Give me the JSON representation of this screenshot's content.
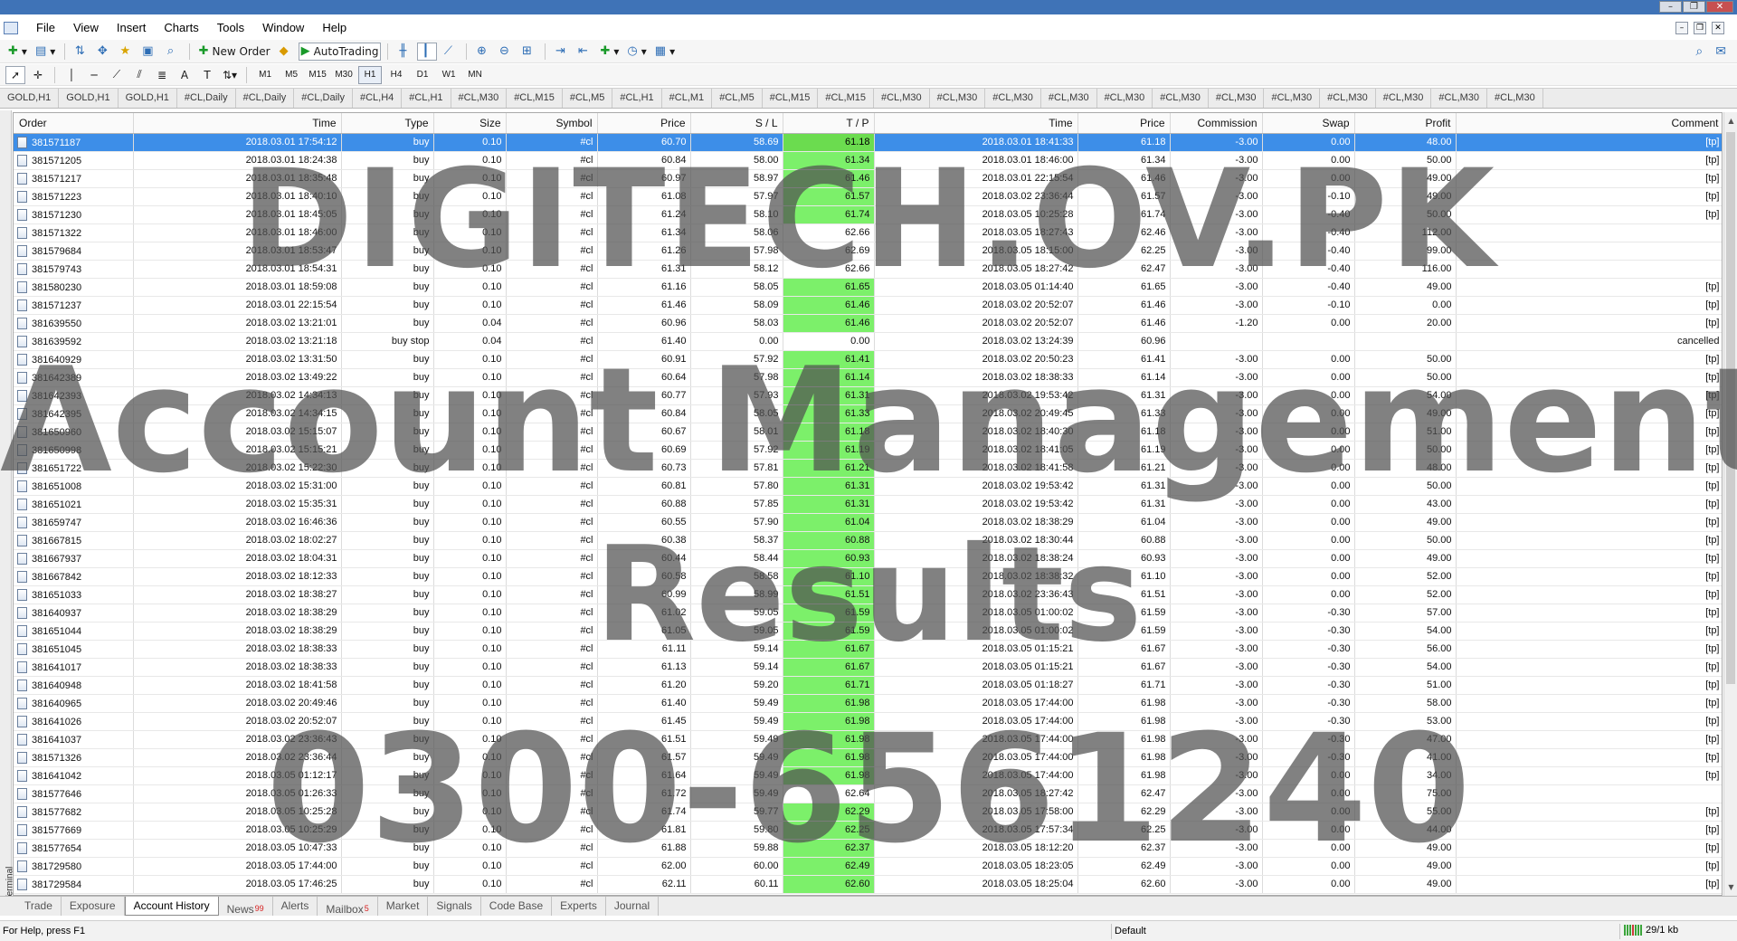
{
  "menu": [
    "File",
    "View",
    "Insert",
    "Charts",
    "Tools",
    "Window",
    "Help"
  ],
  "toolbar": {
    "new_order": "New Order",
    "autotrading": "AutoTrading"
  },
  "timeframes": [
    "M1",
    "M5",
    "M15",
    "M30",
    "H1",
    "H4",
    "D1",
    "W1",
    "MN"
  ],
  "active_timeframe": "H1",
  "chart_tabs": [
    "GOLD,H1",
    "GOLD,H1",
    "GOLD,H1",
    "#CL,Daily",
    "#CL,Daily",
    "#CL,Daily",
    "#CL,H4",
    "#CL,H1",
    "#CL,M30",
    "#CL,M15",
    "#CL,M5",
    "#CL,H1",
    "#CL,M1",
    "#CL,M5",
    "#CL,M15",
    "#CL,M15",
    "#CL,M30",
    "#CL,M30",
    "#CL,M30",
    "#CL,M30",
    "#CL,M30",
    "#CL,M30",
    "#CL,M30",
    "#CL,M30",
    "#CL,M30",
    "#CL,M30",
    "#CL,M30",
    "#CL,M30"
  ],
  "columns": [
    "Order",
    "Time",
    "Type",
    "Size",
    "Symbol",
    "Price",
    "S / L",
    "T / P",
    "Time",
    "Price",
    "Commission",
    "Swap",
    "Profit",
    "Comment"
  ],
  "rows": [
    [
      "381571187",
      "2018.03.01 17:54:12",
      "buy",
      "0.10",
      "#cl",
      "60.70",
      "58.69",
      "61.18",
      "2018.03.01 18:41:33",
      "61.18",
      "-3.00",
      "0.00",
      "48.00",
      "[tp]"
    ],
    [
      "381571205",
      "2018.03.01 18:24:38",
      "buy",
      "0.10",
      "#cl",
      "60.84",
      "58.00",
      "61.34",
      "2018.03.01 18:46:00",
      "61.34",
      "-3.00",
      "0.00",
      "50.00",
      "[tp]"
    ],
    [
      "381571217",
      "2018.03.01 18:35:48",
      "buy",
      "0.10",
      "#cl",
      "60.97",
      "58.97",
      "61.46",
      "2018.03.01 22:15:54",
      "61.46",
      "-3.00",
      "0.00",
      "49.00",
      "[tp]"
    ],
    [
      "381571223",
      "2018.03.01 18:40:10",
      "buy",
      "0.10",
      "#cl",
      "61.08",
      "57.97",
      "61.57",
      "2018.03.02 23:36:44",
      "61.57",
      "-3.00",
      "-0.10",
      "49.00",
      "[tp]"
    ],
    [
      "381571230",
      "2018.03.01 18:45:05",
      "buy",
      "0.10",
      "#cl",
      "61.24",
      "58.10",
      "61.74",
      "2018.03.05 10:25:28",
      "61.74",
      "-3.00",
      "-0.40",
      "50.00",
      "[tp]"
    ],
    [
      "381571322",
      "2018.03.01 18:46:00",
      "buy",
      "0.10",
      "#cl",
      "61.34",
      "58.06",
      "62.66",
      "2018.03.05 18:27:43",
      "62.46",
      "-3.00",
      "-0.40",
      "112.00",
      ""
    ],
    [
      "381579684",
      "2018.03.01 18:53:47",
      "buy",
      "0.10",
      "#cl",
      "61.26",
      "57.98",
      "62.69",
      "2018.03.05 18:15:00",
      "62.25",
      "-3.00",
      "-0.40",
      "99.00",
      ""
    ],
    [
      "381579743",
      "2018.03.01 18:54:31",
      "buy",
      "0.10",
      "#cl",
      "61.31",
      "58.12",
      "62.66",
      "2018.03.05 18:27:42",
      "62.47",
      "-3.00",
      "-0.40",
      "116.00",
      ""
    ],
    [
      "381580230",
      "2018.03.01 18:59:08",
      "buy",
      "0.10",
      "#cl",
      "61.16",
      "58.05",
      "61.65",
      "2018.03.05 01:14:40",
      "61.65",
      "-3.00",
      "-0.40",
      "49.00",
      "[tp]"
    ],
    [
      "381571237",
      "2018.03.01 22:15:54",
      "buy",
      "0.10",
      "#cl",
      "61.46",
      "58.09",
      "61.46",
      "2018.03.02 20:52:07",
      "61.46",
      "-3.00",
      "-0.10",
      "0.00",
      "[tp]"
    ],
    [
      "381639550",
      "2018.03.02 13:21:01",
      "buy",
      "0.04",
      "#cl",
      "60.96",
      "58.03",
      "61.46",
      "2018.03.02 20:52:07",
      "61.46",
      "-1.20",
      "0.00",
      "20.00",
      "[tp]"
    ],
    [
      "381639592",
      "2018.03.02 13:21:18",
      "buy stop",
      "0.04",
      "#cl",
      "61.40",
      "0.00",
      "0.00",
      "2018.03.02 13:24:39",
      "60.96",
      "",
      "",
      "",
      "cancelled"
    ],
    [
      "381640929",
      "2018.03.02 13:31:50",
      "buy",
      "0.10",
      "#cl",
      "60.91",
      "57.92",
      "61.41",
      "2018.03.02 20:50:23",
      "61.41",
      "-3.00",
      "0.00",
      "50.00",
      "[tp]"
    ],
    [
      "381642389",
      "2018.03.02 13:49:22",
      "buy",
      "0.10",
      "#cl",
      "60.64",
      "57.98",
      "61.14",
      "2018.03.02 18:38:33",
      "61.14",
      "-3.00",
      "0.00",
      "50.00",
      "[tp]"
    ],
    [
      "381642393",
      "2018.03.02 14:34:13",
      "buy",
      "0.10",
      "#cl",
      "60.77",
      "57.93",
      "61.31",
      "2018.03.02 19:53:42",
      "61.31",
      "-3.00",
      "0.00",
      "54.00",
      "[tp]"
    ],
    [
      "381642395",
      "2018.03.02 14:34:15",
      "buy",
      "0.10",
      "#cl",
      "60.84",
      "58.05",
      "61.33",
      "2018.03.02 20:49:45",
      "61.33",
      "-3.00",
      "0.00",
      "49.00",
      "[tp]"
    ],
    [
      "381650960",
      "2018.03.02 15:15:07",
      "buy",
      "0.10",
      "#cl",
      "60.67",
      "58.01",
      "61.18",
      "2018.03.02 18:40:30",
      "61.18",
      "-3.00",
      "0.00",
      "51.00",
      "[tp]"
    ],
    [
      "381650998",
      "2018.03.02 15:15:21",
      "buy",
      "0.10",
      "#cl",
      "60.69",
      "57.92",
      "61.19",
      "2018.03.02 18:41:05",
      "61.19",
      "-3.00",
      "0.00",
      "50.00",
      "[tp]"
    ],
    [
      "381651722",
      "2018.03.02 15:22:30",
      "buy",
      "0.10",
      "#cl",
      "60.73",
      "57.81",
      "61.21",
      "2018.03.02 18:41:58",
      "61.21",
      "-3.00",
      "0.00",
      "48.00",
      "[tp]"
    ],
    [
      "381651008",
      "2018.03.02 15:31:00",
      "buy",
      "0.10",
      "#cl",
      "60.81",
      "57.80",
      "61.31",
      "2018.03.02 19:53:42",
      "61.31",
      "-3.00",
      "0.00",
      "50.00",
      "[tp]"
    ],
    [
      "381651021",
      "2018.03.02 15:35:31",
      "buy",
      "0.10",
      "#cl",
      "60.88",
      "57.85",
      "61.31",
      "2018.03.02 19:53:42",
      "61.31",
      "-3.00",
      "0.00",
      "43.00",
      "[tp]"
    ],
    [
      "381659747",
      "2018.03.02 16:46:36",
      "buy",
      "0.10",
      "#cl",
      "60.55",
      "57.90",
      "61.04",
      "2018.03.02 18:38:29",
      "61.04",
      "-3.00",
      "0.00",
      "49.00",
      "[tp]"
    ],
    [
      "381667815",
      "2018.03.02 18:02:27",
      "buy",
      "0.10",
      "#cl",
      "60.38",
      "58.37",
      "60.88",
      "2018.03.02 18:30:44",
      "60.88",
      "-3.00",
      "0.00",
      "50.00",
      "[tp]"
    ],
    [
      "381667937",
      "2018.03.02 18:04:31",
      "buy",
      "0.10",
      "#cl",
      "60.44",
      "58.44",
      "60.93",
      "2018.03.02 18:38:24",
      "60.93",
      "-3.00",
      "0.00",
      "49.00",
      "[tp]"
    ],
    [
      "381667842",
      "2018.03.02 18:12:33",
      "buy",
      "0.10",
      "#cl",
      "60.58",
      "58.58",
      "61.10",
      "2018.03.02 18:38:32",
      "61.10",
      "-3.00",
      "0.00",
      "52.00",
      "[tp]"
    ],
    [
      "381651033",
      "2018.03.02 18:38:27",
      "buy",
      "0.10",
      "#cl",
      "60.99",
      "58.99",
      "61.51",
      "2018.03.02 23:36:43",
      "61.51",
      "-3.00",
      "0.00",
      "52.00",
      "[tp]"
    ],
    [
      "381640937",
      "2018.03.02 18:38:29",
      "buy",
      "0.10",
      "#cl",
      "61.02",
      "59.05",
      "61.59",
      "2018.03.05 01:00:02",
      "61.59",
      "-3.00",
      "-0.30",
      "57.00",
      "[tp]"
    ],
    [
      "381651044",
      "2018.03.02 18:38:29",
      "buy",
      "0.10",
      "#cl",
      "61.05",
      "59.05",
      "61.59",
      "2018.03.05 01:00:02",
      "61.59",
      "-3.00",
      "-0.30",
      "54.00",
      "[tp]"
    ],
    [
      "381651045",
      "2018.03.02 18:38:33",
      "buy",
      "0.10",
      "#cl",
      "61.11",
      "59.14",
      "61.67",
      "2018.03.05 01:15:21",
      "61.67",
      "-3.00",
      "-0.30",
      "56.00",
      "[tp]"
    ],
    [
      "381641017",
      "2018.03.02 18:38:33",
      "buy",
      "0.10",
      "#cl",
      "61.13",
      "59.14",
      "61.67",
      "2018.03.05 01:15:21",
      "61.67",
      "-3.00",
      "-0.30",
      "54.00",
      "[tp]"
    ],
    [
      "381640948",
      "2018.03.02 18:41:58",
      "buy",
      "0.10",
      "#cl",
      "61.20",
      "59.20",
      "61.71",
      "2018.03.05 01:18:27",
      "61.71",
      "-3.00",
      "-0.30",
      "51.00",
      "[tp]"
    ],
    [
      "381640965",
      "2018.03.02 20:49:46",
      "buy",
      "0.10",
      "#cl",
      "61.40",
      "59.49",
      "61.98",
      "2018.03.05 17:44:00",
      "61.98",
      "-3.00",
      "-0.30",
      "58.00",
      "[tp]"
    ],
    [
      "381641026",
      "2018.03.02 20:52:07",
      "buy",
      "0.10",
      "#cl",
      "61.45",
      "59.49",
      "61.98",
      "2018.03.05 17:44:00",
      "61.98",
      "-3.00",
      "-0.30",
      "53.00",
      "[tp]"
    ],
    [
      "381641037",
      "2018.03.02 23:36:43",
      "buy",
      "0.10",
      "#cl",
      "61.51",
      "59.49",
      "61.98",
      "2018.03.05 17:44:00",
      "61.98",
      "-3.00",
      "-0.30",
      "47.00",
      "[tp]"
    ],
    [
      "381571326",
      "2018.03.02 23:36:44",
      "buy",
      "0.10",
      "#cl",
      "61.57",
      "59.49",
      "61.98",
      "2018.03.05 17:44:00",
      "61.98",
      "-3.00",
      "-0.30",
      "41.00",
      "[tp]"
    ],
    [
      "381641042",
      "2018.03.05 01:12:17",
      "buy",
      "0.10",
      "#cl",
      "61.64",
      "59.49",
      "61.98",
      "2018.03.05 17:44:00",
      "61.98",
      "-3.00",
      "0.00",
      "34.00",
      "[tp]"
    ],
    [
      "381577646",
      "2018.03.05 01:26:33",
      "buy",
      "0.10",
      "#cl",
      "61.72",
      "59.49",
      "62.64",
      "2018.03.05 18:27:42",
      "62.47",
      "-3.00",
      "0.00",
      "75.00",
      ""
    ],
    [
      "381577682",
      "2018.03.05 10:25:28",
      "buy",
      "0.10",
      "#cl",
      "61.74",
      "59.77",
      "62.29",
      "2018.03.05 17:58:00",
      "62.29",
      "-3.00",
      "0.00",
      "55.00",
      "[tp]"
    ],
    [
      "381577669",
      "2018.03.05 10:25:29",
      "buy",
      "0.10",
      "#cl",
      "61.81",
      "59.80",
      "62.25",
      "2018.03.05 17:57:34",
      "62.25",
      "-3.00",
      "0.00",
      "44.00",
      "[tp]"
    ],
    [
      "381577654",
      "2018.03.05 10:47:33",
      "buy",
      "0.10",
      "#cl",
      "61.88",
      "59.88",
      "62.37",
      "2018.03.05 18:12:20",
      "62.37",
      "-3.00",
      "0.00",
      "49.00",
      "[tp]"
    ],
    [
      "381729580",
      "2018.03.05 17:44:00",
      "buy",
      "0.10",
      "#cl",
      "62.00",
      "60.00",
      "62.49",
      "2018.03.05 18:23:05",
      "62.49",
      "-3.00",
      "0.00",
      "49.00",
      "[tp]"
    ],
    [
      "381729584",
      "2018.03.05 17:46:25",
      "buy",
      "0.10",
      "#cl",
      "62.11",
      "60.11",
      "62.60",
      "2018.03.05 18:25:04",
      "62.60",
      "-3.00",
      "0.00",
      "49.00",
      "[tp]"
    ]
  ],
  "selected_row": 0,
  "terminal_label": "Terminal",
  "bottom_tabs": [
    {
      "label": "Trade",
      "badge": ""
    },
    {
      "label": "Exposure",
      "badge": ""
    },
    {
      "label": "Account History",
      "badge": ""
    },
    {
      "label": "News",
      "badge": "99"
    },
    {
      "label": "Alerts",
      "badge": ""
    },
    {
      "label": "Mailbox",
      "badge": "5"
    },
    {
      "label": "Market",
      "badge": ""
    },
    {
      "label": "Signals",
      "badge": ""
    },
    {
      "label": "Code Base",
      "badge": ""
    },
    {
      "label": "Experts",
      "badge": ""
    },
    {
      "label": "Journal",
      "badge": ""
    }
  ],
  "active_bottom_tab": "Account History",
  "status": {
    "help": "For Help, press F1",
    "profile": "Default",
    "traffic": "29/1 kb"
  },
  "watermark": [
    "DIGITECH.OV.PK",
    "Account Management",
    "Results",
    "0300-6561240"
  ],
  "colors": {
    "tp_hit": "#7cf06a",
    "selection": "#3d8ee8",
    "titlebar": "#3f73b7"
  }
}
